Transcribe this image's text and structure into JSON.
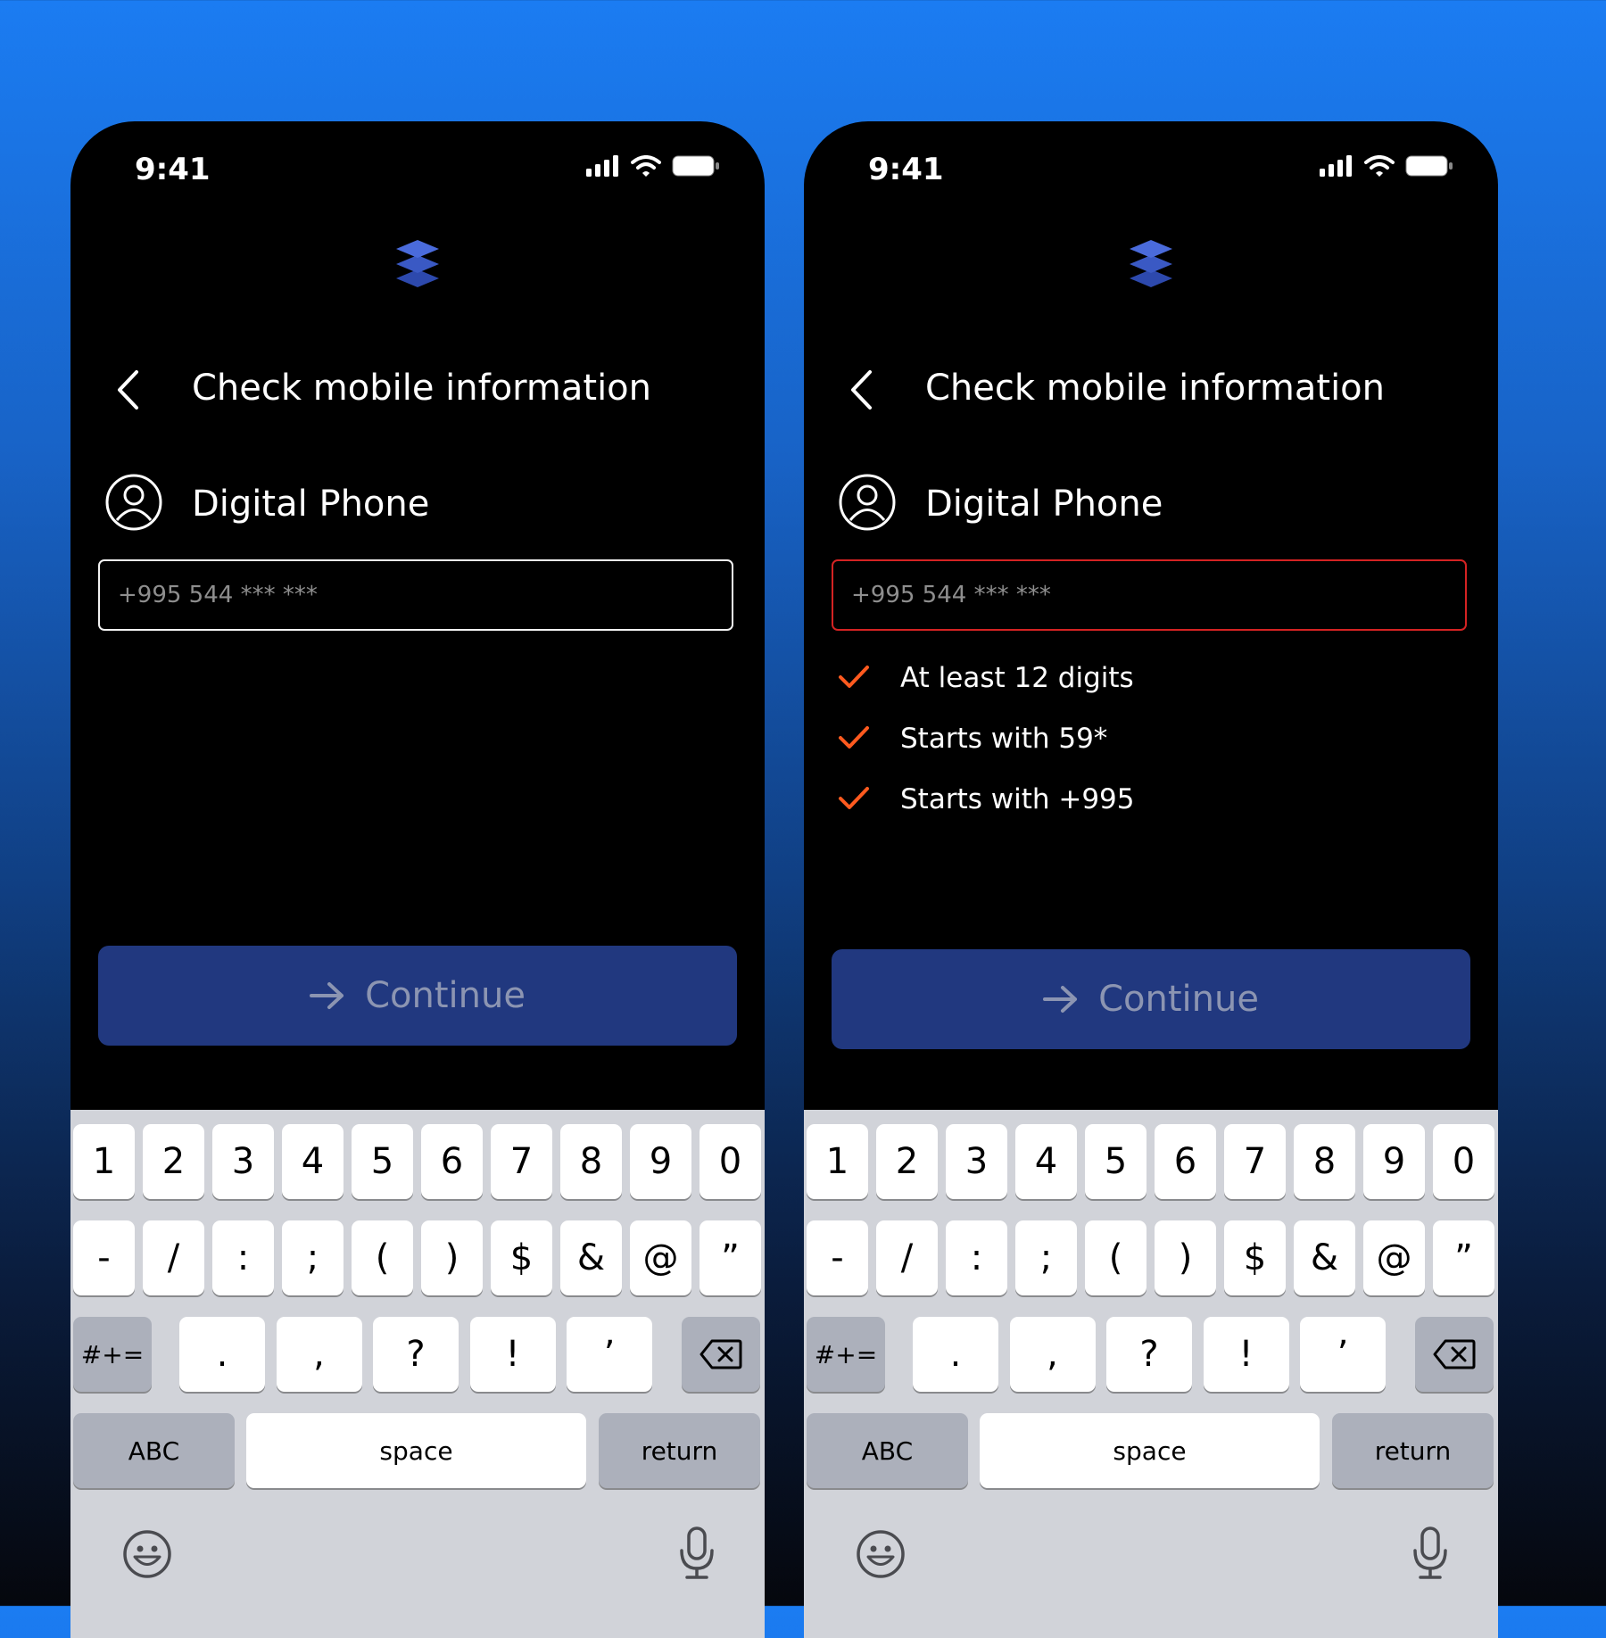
{
  "screens": [
    {
      "status": {
        "time": "9:41"
      },
      "header": {
        "title": "Check mobile information"
      },
      "account": {
        "label": "Digital Phone"
      },
      "phone_field": {
        "placeholder": "+995 544 *** ***",
        "state": "default"
      },
      "requirements": [],
      "continue_button": {
        "label": "Continue"
      }
    },
    {
      "status": {
        "time": "9:41"
      },
      "header": {
        "title": "Check mobile information"
      },
      "account": {
        "label": "Digital Phone"
      },
      "phone_field": {
        "placeholder": "+995 544 *** ***",
        "state": "error"
      },
      "requirements": [
        {
          "label": "At least 12 digits"
        },
        {
          "label": "Starts with 59*"
        },
        {
          "label": "Starts with +995"
        }
      ],
      "continue_button": {
        "label": "Continue"
      }
    }
  ],
  "keyboard": {
    "row1": [
      "1",
      "2",
      "3",
      "4",
      "5",
      "6",
      "7",
      "8",
      "9",
      "0"
    ],
    "row2": [
      "-",
      "/",
      ":",
      ";",
      "(",
      ")",
      "$",
      "&",
      "@",
      "”"
    ],
    "symbols_toggle": "#+=",
    "row3": [
      ".",
      ",",
      "?",
      "!",
      "’"
    ],
    "abc_label": "ABC",
    "space_label": "space",
    "return_label": "return"
  },
  "colors": {
    "background_top": "#1b7cf2",
    "background_bottom": "#05070d",
    "screen_bg": "#000000",
    "button_bg": "#21387f",
    "button_text": "#8c95b2",
    "error_border": "#d42323",
    "check_color": "#ff5a1f",
    "logo_color": "#3f5fd6"
  },
  "icons": [
    "cellular-signal-icon",
    "wifi-icon",
    "battery-icon",
    "layers-logo-icon",
    "chevron-left-icon",
    "user-circle-icon",
    "checkmark-icon",
    "arrow-right-icon",
    "backspace-icon",
    "emoji-icon",
    "microphone-icon"
  ]
}
